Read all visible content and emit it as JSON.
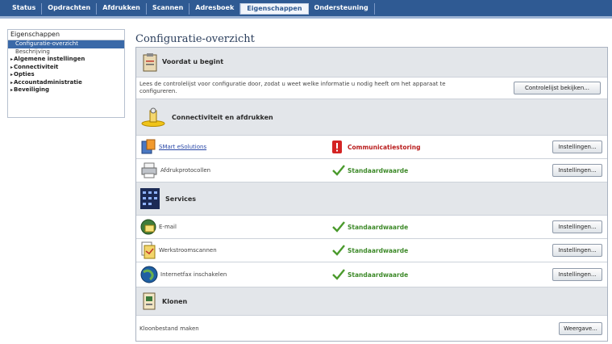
{
  "nav": {
    "tabs": [
      "Status",
      "Opdrachten",
      "Afdrukken",
      "Scannen",
      "Adresboek",
      "Eigenschappen",
      "Ondersteuning"
    ],
    "active": "Eigenschappen"
  },
  "sidebar": {
    "header": "Eigenschappen",
    "items": [
      {
        "label": "Configuratie-overzicht"
      },
      {
        "label": "Beschrijving"
      },
      {
        "label": "Algemene instellingen"
      },
      {
        "label": "Connectiviteit"
      },
      {
        "label": "Opties"
      },
      {
        "label": "Accountadministratie"
      },
      {
        "label": "Beveiliging"
      }
    ]
  },
  "main": {
    "title": "Configuratie-overzicht",
    "sections": {
      "start": {
        "title": "Voordat u begint",
        "text": "Lees de controlelijst voor configuratie door, zodat u weet welke informatie u nodig heeft om het apparaat te configureren.",
        "button": "Controlelijst bekijken..."
      },
      "connectivity": {
        "title": "Connectiviteit en afdrukken",
        "rows": [
          {
            "label": "SMart eSolutions",
            "status": "Communicatiestoring",
            "button": "Instellingen..."
          },
          {
            "label": "Afdrukprotocollen",
            "status": "Standaardwaarde",
            "button": "Instellingen..."
          }
        ]
      },
      "services": {
        "title": "Services",
        "rows": [
          {
            "label": "E-mail",
            "status": "Standaardwaarde",
            "button": "Instellingen..."
          },
          {
            "label": "Werkstroomscannen",
            "status": "Standaardwaarde",
            "button": "Instellingen..."
          },
          {
            "label": "Internetfax inschakelen",
            "status": "Standaardwaarde",
            "button": "Instellingen..."
          }
        ]
      },
      "clone": {
        "title": "Klonen",
        "text": "Kloonbestand maken",
        "button": "Weergave..."
      }
    }
  },
  "colors": {
    "nav_bg": "#2f5a93",
    "status_ok": "#3e8a2a",
    "status_error": "#b91c1c",
    "link": "#2746a6"
  }
}
